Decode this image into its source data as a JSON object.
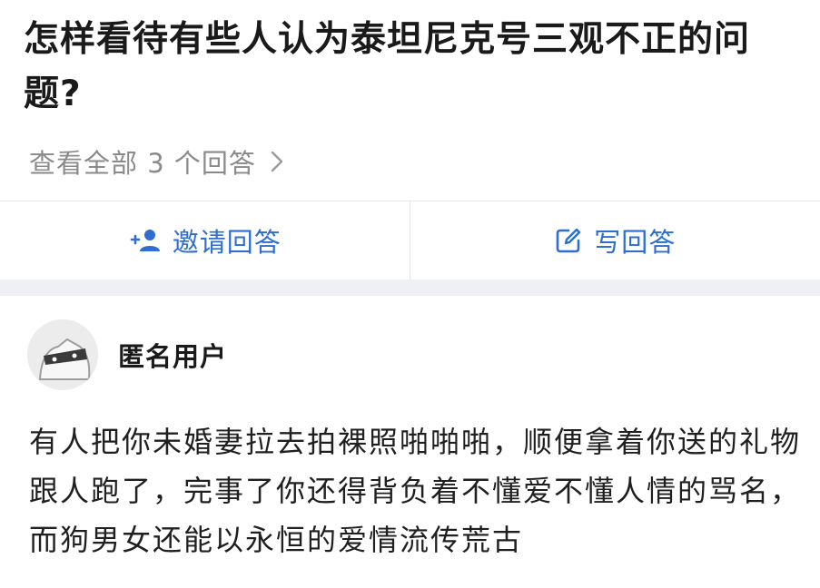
{
  "question": {
    "title": "怎样看待有些人认为泰坦尼克号三观不正的问题?",
    "view_all_label": "查看全部 3 个回答"
  },
  "actions": {
    "invite_label": "邀请回答",
    "write_label": "写回答"
  },
  "answer": {
    "author": "匿名用户",
    "content": "有人把你未婚妻拉去拍裸照啪啪啪，顺便拿着你送的礼物跟人跑了，完事了你还得背负着不懂爱不懂人情的骂名，而狗男女还能以永恒的爱情流传荒古"
  },
  "colors": {
    "accent": "#2d6ed0",
    "secondary_text": "#8a8a8a",
    "gap": "#eef0f3"
  },
  "icons": {
    "view_all": "chevron-right-icon",
    "invite": "add-person-icon",
    "write": "edit-icon",
    "avatar": "anonymous-avatar-icon"
  }
}
